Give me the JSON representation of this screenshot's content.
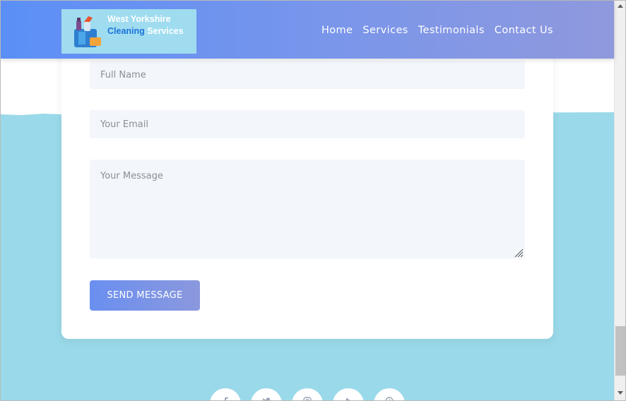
{
  "header": {
    "logo": {
      "line1": "West Yorkshire",
      "line2a": "Cleaning",
      "line2b": "Services"
    },
    "nav": [
      "Home",
      "Services",
      "Testimonials",
      "Contact Us"
    ]
  },
  "form": {
    "name_placeholder": "Full Name",
    "email_placeholder": "Your Email",
    "message_placeholder": "Your Message",
    "submit_label": "SEND MESSAGE"
  },
  "social_icons": [
    "facebook-icon",
    "twitter-icon",
    "instagram-icon",
    "youtube-icon",
    "pinterest-icon"
  ],
  "colors": {
    "nav_gradient_start": "#5b8ff6",
    "nav_gradient_end": "#8f99dd",
    "page_background": "#9ad9e9",
    "field_background": "#f3f6fa",
    "button_gradient_start": "#6a8ff0",
    "button_gradient_end": "#8b98dd"
  }
}
